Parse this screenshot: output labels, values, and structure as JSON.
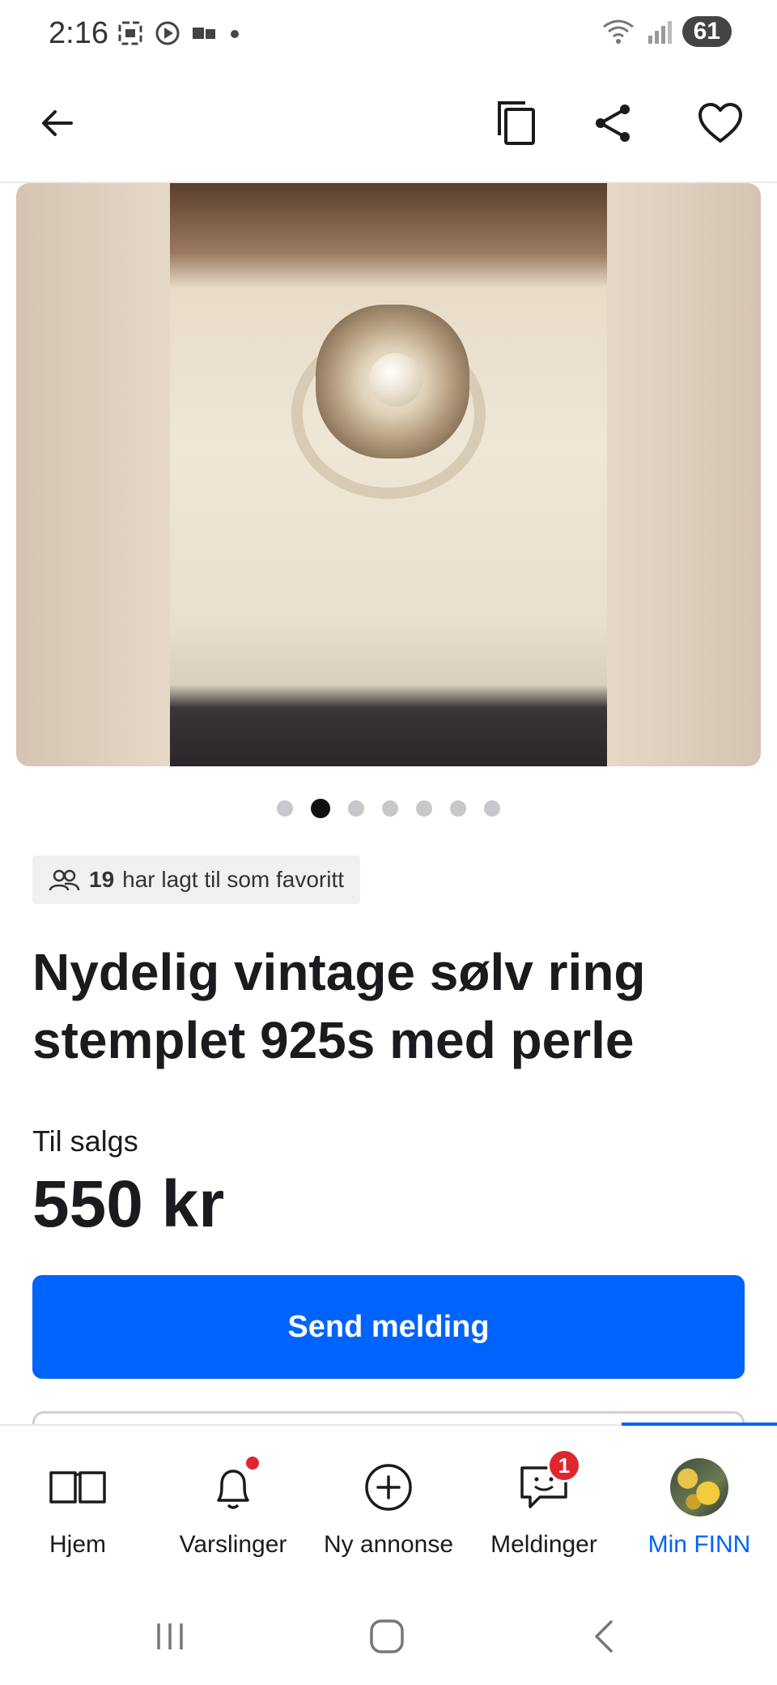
{
  "status_bar": {
    "time": "2:16",
    "battery": "61"
  },
  "top_bar": {
    "back_icon": "arrow-left-icon",
    "copy_icon": "copy-icon",
    "share_icon": "share-icon",
    "favorite_icon": "heart-icon"
  },
  "gallery": {
    "image_count": 7,
    "active_index": 1
  },
  "listing": {
    "favorites_count": "19",
    "favorites_text": "har lagt til som favoritt",
    "title": "Nydelig vintage sølv ring stemplet 925s med perle",
    "sale_label": "Til salgs",
    "price": "550 kr",
    "send_button": "Send melding"
  },
  "bottom_nav": {
    "items": [
      {
        "label": "Hjem",
        "icon": "book-icon"
      },
      {
        "label": "Varslinger",
        "icon": "bell-icon"
      },
      {
        "label": "Ny annonse",
        "icon": "plus-circle-icon"
      },
      {
        "label": "Meldinger",
        "icon": "chat-icon",
        "badge": "1"
      },
      {
        "label": "Min FINN",
        "icon": "avatar"
      }
    ],
    "active_index": 4
  },
  "colors": {
    "accent": "#0063fb",
    "badge": "#e0252f"
  }
}
